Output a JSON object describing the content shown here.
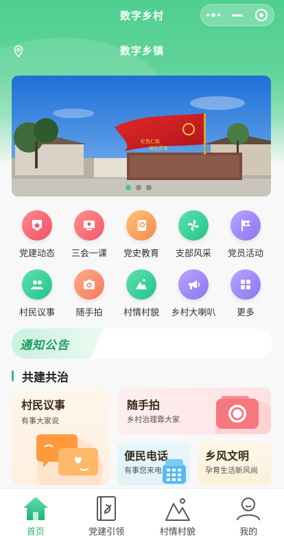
{
  "window": {
    "title": "数字乡村"
  },
  "location": {
    "title": "数字乡镇"
  },
  "banner": {
    "flag_text_line1": "红色仁和",
    "flag_text_line2": "继往开来",
    "page_count": 3,
    "active_page": 1
  },
  "grid_row1": [
    {
      "label": "党建动态",
      "icon": "star-flag-icon",
      "color_from": "#ff8a8a",
      "color_to": "#f0506a"
    },
    {
      "label": "三会一课",
      "icon": "lecture-icon",
      "color_from": "#ff8f8f",
      "color_to": "#f05a6a"
    },
    {
      "label": "党史教育",
      "icon": "party-book-icon",
      "color_from": "#ffc27a",
      "color_to": "#f7894a"
    },
    {
      "label": "支部风采",
      "icon": "pinwheel-icon",
      "color_from": "#5fe0b0",
      "color_to": "#22c48a"
    },
    {
      "label": "党员活动",
      "icon": "flag-icon",
      "color_from": "#b9a6ff",
      "color_to": "#8b74f0"
    }
  ],
  "grid_row2": [
    {
      "label": "村民议事",
      "icon": "people-icon",
      "color_from": "#5fe0b0",
      "color_to": "#22c48a"
    },
    {
      "label": "随手拍",
      "icon": "camera-icon",
      "color_from": "#ffab8a",
      "color_to": "#f57a5a"
    },
    {
      "label": "村情村貌",
      "icon": "mountain-icon",
      "color_from": "#5fe0b0",
      "color_to": "#22c48a"
    },
    {
      "label": "乡村大喇叭",
      "icon": "megaphone-icon",
      "color_from": "#b9a6ff",
      "color_to": "#8b74f0"
    },
    {
      "label": "更多",
      "icon": "grid-more-icon",
      "color_from": "#b9a6ff",
      "color_to": "#8b74f0"
    }
  ],
  "notice": {
    "label": "通知公告"
  },
  "section": {
    "title": "共建共治"
  },
  "cards": {
    "villager": {
      "title": "村民议事",
      "subtitle": "有事大家说"
    },
    "snapshot": {
      "title": "随手拍",
      "subtitle": "乡村治理靠大家"
    },
    "phone": {
      "title": "便民电话",
      "subtitle": "有事您来电"
    },
    "custom": {
      "title": "乡风文明",
      "subtitle": "孕育生活新风尚"
    }
  },
  "tabbar": [
    {
      "label": "首页",
      "icon": "home-icon",
      "active": true
    },
    {
      "label": "党建引领",
      "icon": "party-book-icon",
      "active": false
    },
    {
      "label": "村情村貌",
      "icon": "mountain-icon",
      "active": false
    },
    {
      "label": "我的",
      "icon": "user-icon",
      "active": false
    }
  ]
}
